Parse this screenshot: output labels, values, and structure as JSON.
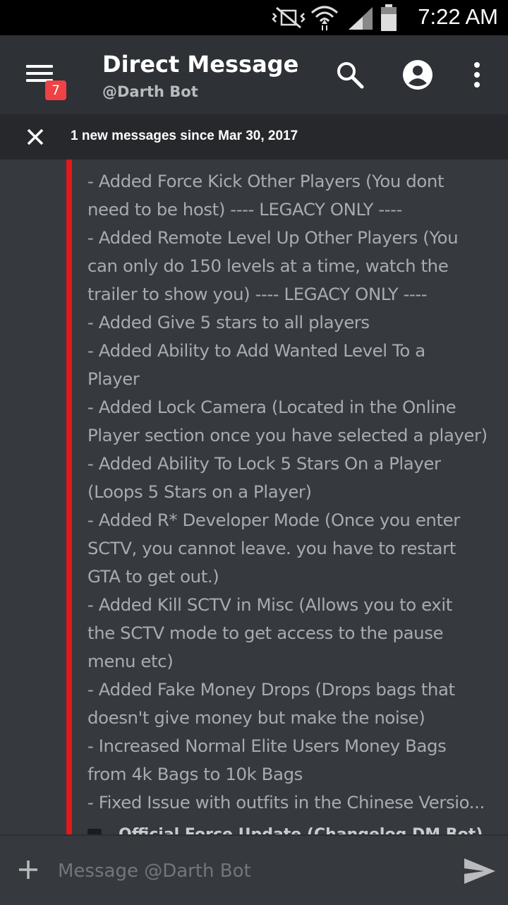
{
  "status_bar": {
    "time": "7:22 AM",
    "icons": [
      "vibrate-mute-icon",
      "wifi-icon",
      "signal-icon",
      "battery-icon"
    ]
  },
  "app_bar": {
    "title": "Direct Message",
    "subtitle": "@Darth Bot",
    "badge_count": "7",
    "icons": [
      "menu-icon",
      "search-icon",
      "profile-icon",
      "more-vertical-icon"
    ]
  },
  "notice": {
    "text": "1 new messages since Mar 30, 2017"
  },
  "embed": {
    "accent_color": "#e3181b",
    "lines": [
      "- Added Force Kick Other Players (You dont",
      "need to be host) ---- LEGACY ONLY ----",
      "- Added Remote Level Up Other Players (You",
      "can only do 150 levels at a time, watch the",
      "trailer to show you) ---- LEGACY ONLY ----",
      "- Added Give 5 stars to all players",
      "- Added Ability to Add Wanted Level To a",
      "Player",
      "- Added Lock Camera (Located in the Online",
      "Player section once you have selected a player)",
      "- Added Ability To Lock 5 Stars On a Player",
      "(Loops 5 Stars on a Player)",
      "- Added R* Developer Mode (Once you enter",
      "SCTV, you cannot leave. you have to restart",
      "GTA to get out.)",
      "- Added Kill SCTV in Misc (Allows you to exit",
      "the SCTV mode to get access to the pause",
      "menu etc)",
      "- Added Fake Money Drops (Drops bags that",
      "doesn't give money but make the noise)",
      "- Increased Normal Elite Users Money Bags",
      "from 4k Bags to 10k Bags",
      "- Fixed Issue with outfits in the Chinese Versio..."
    ],
    "footer_text": "Official Force Update (Changelog DM Bot)"
  },
  "composer": {
    "placeholder": "Message @Darth Bot",
    "value": ""
  },
  "colors": {
    "background": "#36393e",
    "app_bar": "#2e3136",
    "notice_bar": "#26282c",
    "badge": "#ef4245",
    "embed_text": "#a8abb0"
  }
}
